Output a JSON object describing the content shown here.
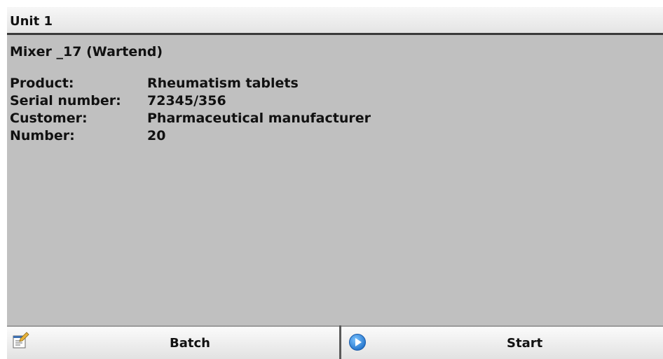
{
  "header": {
    "title": "Unit 1"
  },
  "unit": {
    "name": "Mixer _17 (Wartend)"
  },
  "details": [
    {
      "label": "Product:",
      "value": "Rheumatism tablets"
    },
    {
      "label": "Serial number:",
      "value": "72345/356"
    },
    {
      "label": "Customer:",
      "value": "Pharmaceutical manufacturer"
    },
    {
      "label": "Number:",
      "value": "20"
    }
  ],
  "toolbar": {
    "batch_label": "Batch",
    "batch_icon": "batch-properties-icon",
    "start_label": "Start",
    "start_icon": "start-play-icon"
  },
  "colors": {
    "background": "#c0c0c0",
    "start_icon": "#1e7fd8"
  }
}
